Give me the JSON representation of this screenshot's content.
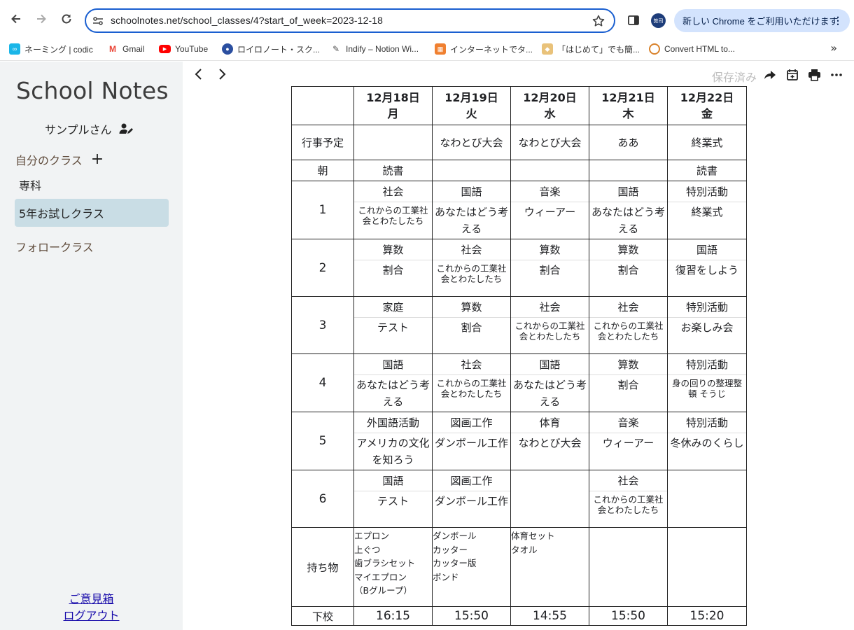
{
  "browser": {
    "url": "schoolnotes.net/school_classes/4?start_of_week=2023-12-18",
    "profile_label": "敦司",
    "update_label": "新しい Chrome をご利用いただけます",
    "bookmarks": [
      {
        "label": "ネーミング | codic",
        "icon": "codic-icon",
        "color": "#1ab6e8"
      },
      {
        "label": "Gmail",
        "icon": "gmail-icon",
        "color": "#ea4335"
      },
      {
        "label": "YouTube",
        "icon": "youtube-icon",
        "color": "#ff0000"
      },
      {
        "label": "ロイロノート・スク...",
        "icon": "loilo-icon",
        "color": "#2b4fa0"
      },
      {
        "label": "Indify – Notion Wi...",
        "icon": "indify-icon",
        "color": "#555555"
      },
      {
        "label": "インターネットでタ...",
        "icon": "typing-icon",
        "color": "#f08030"
      },
      {
        "label": "「はじめて」でも簡...",
        "icon": "hajimete-icon",
        "color": "#e9c27a"
      },
      {
        "label": "Convert HTML to...",
        "icon": "convert-icon",
        "color": "#d9822b"
      }
    ]
  },
  "sidebar": {
    "app_title": "School Notes",
    "user_name": "サンプルさん",
    "my_classes_label": "自分のクラス",
    "items": [
      {
        "label": "専科"
      },
      {
        "label": "5年お試しクラス"
      }
    ],
    "follow_label": "フォロークラス",
    "feedback_label": "ご意見箱",
    "logout_label": "ログアウト"
  },
  "toolbar": {
    "saved_label": "保存済み"
  },
  "timetable": {
    "days": [
      {
        "date": "12月18日",
        "weekday": "月"
      },
      {
        "date": "12月19日",
        "weekday": "火"
      },
      {
        "date": "12月20日",
        "weekday": "水"
      },
      {
        "date": "12月21日",
        "weekday": "木"
      },
      {
        "date": "12月22日",
        "weekday": "金"
      }
    ],
    "events_label": "行事予定",
    "events": [
      "",
      "なわとび大会",
      "なわとび大会",
      "ああ",
      "終業式"
    ],
    "morning_label": "朝",
    "morning": [
      "読書",
      "",
      "",
      "",
      "読書"
    ],
    "periods": [
      {
        "label": "1",
        "cells": [
          {
            "subject": "社会",
            "topic": "これからの工業社会とわたしたち"
          },
          {
            "subject": "国語",
            "topic": "あなたはどう考える"
          },
          {
            "subject": "音楽",
            "topic": "ウィーアー"
          },
          {
            "subject": "国語",
            "topic": "あなたはどう考える"
          },
          {
            "subject": "特別活動",
            "topic": "終業式"
          }
        ]
      },
      {
        "label": "2",
        "cells": [
          {
            "subject": "算数",
            "topic": "割合"
          },
          {
            "subject": "社会",
            "topic": "これからの工業社会とわたしたち"
          },
          {
            "subject": "算数",
            "topic": "割合"
          },
          {
            "subject": "算数",
            "topic": "割合"
          },
          {
            "subject": "国語",
            "topic": "復習をしよう"
          }
        ]
      },
      {
        "label": "3",
        "cells": [
          {
            "subject": "家庭",
            "topic": "テスト"
          },
          {
            "subject": "算数",
            "topic": "割合"
          },
          {
            "subject": "社会",
            "topic": "これからの工業社会とわたしたち"
          },
          {
            "subject": "社会",
            "topic": "これからの工業社会とわたしたち"
          },
          {
            "subject": "特別活動",
            "topic": "お楽しみ会"
          }
        ]
      },
      {
        "label": "4",
        "cells": [
          {
            "subject": "国語",
            "topic": "あなたはどう考える"
          },
          {
            "subject": "社会",
            "topic": "これからの工業社会とわたしたち"
          },
          {
            "subject": "国語",
            "topic": "あなたはどう考える"
          },
          {
            "subject": "算数",
            "topic": "割合"
          },
          {
            "subject": "特別活動",
            "topic": "身の回りの整理整頓 そうじ"
          }
        ]
      },
      {
        "label": "5",
        "cells": [
          {
            "subject": "外国語活動",
            "topic": "アメリカの文化を知ろう"
          },
          {
            "subject": "図画工作",
            "topic": "ダンボール工作"
          },
          {
            "subject": "体育",
            "topic": "なわとび大会"
          },
          {
            "subject": "音楽",
            "topic": "ウィーアー"
          },
          {
            "subject": "特別活動",
            "topic": "冬休みのくらし"
          }
        ]
      },
      {
        "label": "6",
        "cells": [
          {
            "subject": "国語",
            "topic": "テスト"
          },
          {
            "subject": "図画工作",
            "topic": "ダンボール工作"
          },
          {
            "subject": "",
            "topic": ""
          },
          {
            "subject": "社会",
            "topic": "これからの工業社会とわたしたち"
          },
          {
            "subject": "",
            "topic": ""
          }
        ]
      }
    ],
    "belongings_label": "持ち物",
    "belongings": [
      "エプロン\n上ぐつ\n歯ブラシセット\nマイエプロン\n（Bグループ）",
      "ダンボール\nカッター\nカッター版\nボンド",
      "体育セット\nタオル",
      "",
      ""
    ],
    "dismissal_label": "下校",
    "dismissal": [
      "16:15",
      "15:50",
      "14:55",
      "15:50",
      "15:20"
    ]
  }
}
